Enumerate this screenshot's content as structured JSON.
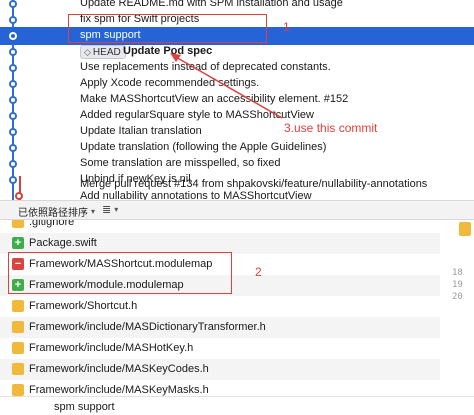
{
  "commits": [
    {
      "message": "Update README.md with SPM installation and usage",
      "selected": false
    },
    {
      "message": "fix spm for Swift projects",
      "selected": false
    },
    {
      "message": "spm support",
      "selected": true
    },
    {
      "message": "Update Pod spec",
      "selected": false,
      "tag": "HEAD"
    },
    {
      "message": "Use replacements instead of deprecated constants.",
      "selected": false
    },
    {
      "message": "Apply Xcode recommended settings.",
      "selected": false
    },
    {
      "message": "Make MASShortcutView an accessibility element. #152",
      "selected": false
    },
    {
      "message": "Added regularSquare style to MASShortcutView",
      "selected": false
    },
    {
      "message": "Update Italian translation",
      "selected": false
    },
    {
      "message": "Update translation (following the Apple Guidelines)",
      "selected": false
    },
    {
      "message": "Some translation are misspelled, so fixed",
      "selected": false
    },
    {
      "message": "Unbind if newKey is nil",
      "selected": false
    },
    {
      "message": "Merge pull request #134 from shpakovski/feature/nullability-annotations",
      "selected": false
    },
    {
      "message": "Add nullability annotations to MASShortcutView",
      "selected": false
    }
  ],
  "annotations": {
    "box1_label": "1",
    "box2_label": "2",
    "note": "3.use this commit"
  },
  "toolbar": {
    "sort_label": "已依照路径排序",
    "view_icon": "≣"
  },
  "files": [
    {
      "status": "modified",
      "name": ".gitignore"
    },
    {
      "status": "added",
      "name": "Package.swift"
    },
    {
      "status": "deleted",
      "name": "Framework/MASShortcut.modulemap"
    },
    {
      "status": "added",
      "name": "Framework/module.modulemap"
    },
    {
      "status": "modified",
      "name": "Framework/Shortcut.h"
    },
    {
      "status": "modified",
      "name": "Framework/include/MASDictionaryTransformer.h"
    },
    {
      "status": "modified",
      "name": "Framework/include/MASHotKey.h"
    },
    {
      "status": "modified",
      "name": "Framework/include/MASKeyCodes.h"
    },
    {
      "status": "modified",
      "name": "Framework/include/MASKeyMasks.h"
    }
  ],
  "line_numbers": [
    "18",
    "19",
    "20"
  ],
  "status_symbols": {
    "added": "+",
    "deleted": "−",
    "modified": ""
  },
  "bottom": {
    "message": "spm support"
  },
  "colors": {
    "accent": "#2563d6",
    "annotation": "#e04040",
    "added": "#3fae4a",
    "deleted": "#d9443f",
    "modified": "#f0b93b"
  }
}
